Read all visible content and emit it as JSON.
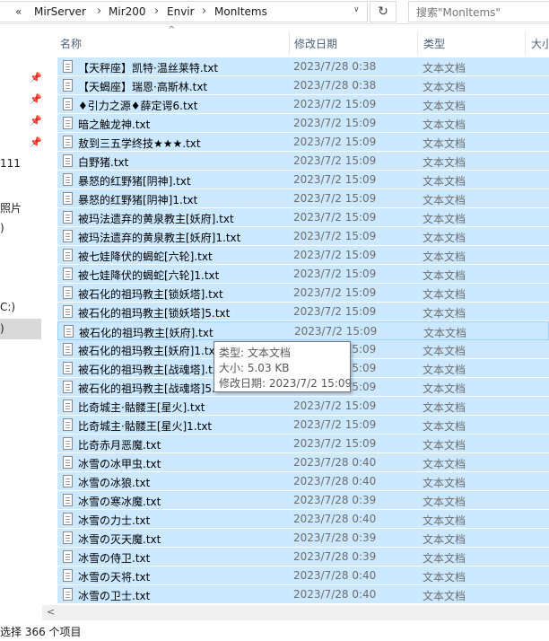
{
  "address": {
    "dblchev": "«",
    "crumbs": [
      "MirServer",
      "Mir200",
      "Envir",
      "MonItems"
    ],
    "separator": "›",
    "dropdown": "∨",
    "refresh": "↻",
    "search_placeholder": "搜索\"MonItems\""
  },
  "nav": {
    "pin_glyph": "📌",
    "fragments": [
      "111",
      "照片",
      ")",
      "C:)",
      ")"
    ]
  },
  "columns": {
    "name": "名称",
    "modified": "修改日期",
    "type": "类型",
    "size": "大小",
    "sort_glyph": "^"
  },
  "files": [
    {
      "name": "【天秤座】凯特·温丝莱特.txt",
      "modified": "2023/7/28 0:38",
      "type": "文本文档"
    },
    {
      "name": "【天蝎座】瑞恩·高斯林.txt",
      "modified": "2023/7/28 0:38",
      "type": "文本文档"
    },
    {
      "name": "♦引力之源♦薛定谔6.txt",
      "modified": "2023/7/2 15:09",
      "type": "文本文档"
    },
    {
      "name": "暗之触龙神.txt",
      "modified": "2023/7/2 15:09",
      "type": "文本文档"
    },
    {
      "name": "敖到三五学终技★★★.txt",
      "modified": "2023/7/2 15:09",
      "type": "文本文档"
    },
    {
      "name": "白野猪.txt",
      "modified": "2023/7/2 15:09",
      "type": "文本文档"
    },
    {
      "name": "暴怒的红野猪[阴神].txt",
      "modified": "2023/7/2 15:09",
      "type": "文本文档"
    },
    {
      "name": "暴怒的红野猪[阴神]1.txt",
      "modified": "2023/7/2 15:09",
      "type": "文本文档"
    },
    {
      "name": "被玛法遗弃的黄泉教主[妖府].txt",
      "modified": "2023/7/2 15:09",
      "type": "文本文档"
    },
    {
      "name": "被玛法遗弃的黄泉教主[妖府]1.txt",
      "modified": "2023/7/2 15:09",
      "type": "文本文档"
    },
    {
      "name": "被七娃降伏的蝎蛇[六轮].txt",
      "modified": "2023/7/2 15:09",
      "type": "文本文档"
    },
    {
      "name": "被七娃降伏的蝎蛇[六轮]1.txt",
      "modified": "2023/7/2 15:09",
      "type": "文本文档"
    },
    {
      "name": "被石化的祖玛教主[锁妖塔].txt",
      "modified": "2023/7/2 15:09",
      "type": "文本文档"
    },
    {
      "name": "被石化的祖玛教主[锁妖塔]5.txt",
      "modified": "2023/7/2 15:09",
      "type": "文本文档"
    },
    {
      "name": "被石化的祖玛教主[妖府].txt",
      "modified": "2023/7/2 15:09",
      "type": "文本文档"
    },
    {
      "name": "被石化的祖玛教主[妖府]1.txt",
      "modified": "2023/7/2 15:09",
      "type": "文本文档"
    },
    {
      "name": "被石化的祖玛教主[战魂塔].txt",
      "modified": "2023/7/2 15:09",
      "type": "文本文档"
    },
    {
      "name": "被石化的祖玛教主[战魂塔]5.txt",
      "modified": "2023/7/2 15:09",
      "type": "文本文档"
    },
    {
      "name": "比奇城主·骷髅王[星火].txt",
      "modified": "2023/7/2 15:09",
      "type": "文本文档"
    },
    {
      "name": "比奇城主·骷髅王[星火]1.txt",
      "modified": "2023/7/2 15:09",
      "type": "文本文档"
    },
    {
      "name": "比奇赤月恶魔.txt",
      "modified": "2023/7/2 15:09",
      "type": "文本文档"
    },
    {
      "name": "冰雪の冰甲虫.txt",
      "modified": "2023/7/28 0:40",
      "type": "文本文档"
    },
    {
      "name": "冰雪の冰狼.txt",
      "modified": "2023/7/28 0:40",
      "type": "文本文档"
    },
    {
      "name": "冰雪の寒冰魔.txt",
      "modified": "2023/7/28 0:39",
      "type": "文本文档"
    },
    {
      "name": "冰雪の力士.txt",
      "modified": "2023/7/28 0:40",
      "type": "文本文档"
    },
    {
      "name": "冰雪の灭天魔.txt",
      "modified": "2023/7/28 0:39",
      "type": "文本文档"
    },
    {
      "name": "冰雪の侍卫.txt",
      "modified": "2023/7/28 0:39",
      "type": "文本文档"
    },
    {
      "name": "冰雪の天将.txt",
      "modified": "2023/7/28 0:40",
      "type": "文本文档"
    },
    {
      "name": "冰雪の卫士.txt",
      "modified": "2023/7/28 0:40",
      "type": "文本文档"
    }
  ],
  "tooltip": {
    "type": "类型: 文本文档",
    "size": "大小: 5.03 KB",
    "modified": "修改日期: 2023/7/2 15:09"
  },
  "scrollbar": {
    "left_arrow": "<"
  },
  "status": {
    "selection": "选择 366 个项目"
  }
}
